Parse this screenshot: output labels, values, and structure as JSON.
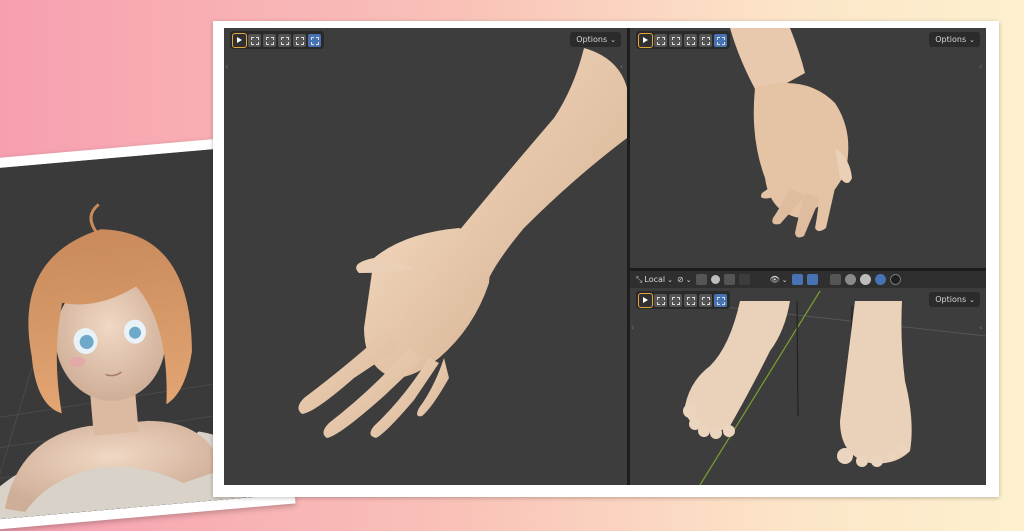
{
  "viewports": {
    "left": {
      "options_label": "Options"
    },
    "top_right": {
      "options_label": "Options"
    },
    "bottom_right": {
      "options_label": "Options",
      "transform_orientation": "Local"
    }
  },
  "icons": {
    "select_tool": "cursor-icon",
    "selection_modes": [
      "new-selection-icon",
      "extend-selection-icon",
      "subtract-selection-icon",
      "invert-selection-icon",
      "intersect-selection-icon"
    ],
    "header": [
      "transform-pivot-icon",
      "snap-icon",
      "proportional-edit-icon",
      "visibility-icon",
      "gizmo-icon",
      "overlay-icon",
      "xray-icon",
      "wireframe-shading-icon",
      "solid-shading-icon",
      "material-shading-icon",
      "rendered-shading-icon"
    ]
  },
  "colors": {
    "viewport_bg": "#3d3d3d",
    "accent_blue": "#4772b3",
    "active_outline": "#e7a53a",
    "skin": "#e9c9ab",
    "hair": "#d79a6a"
  }
}
